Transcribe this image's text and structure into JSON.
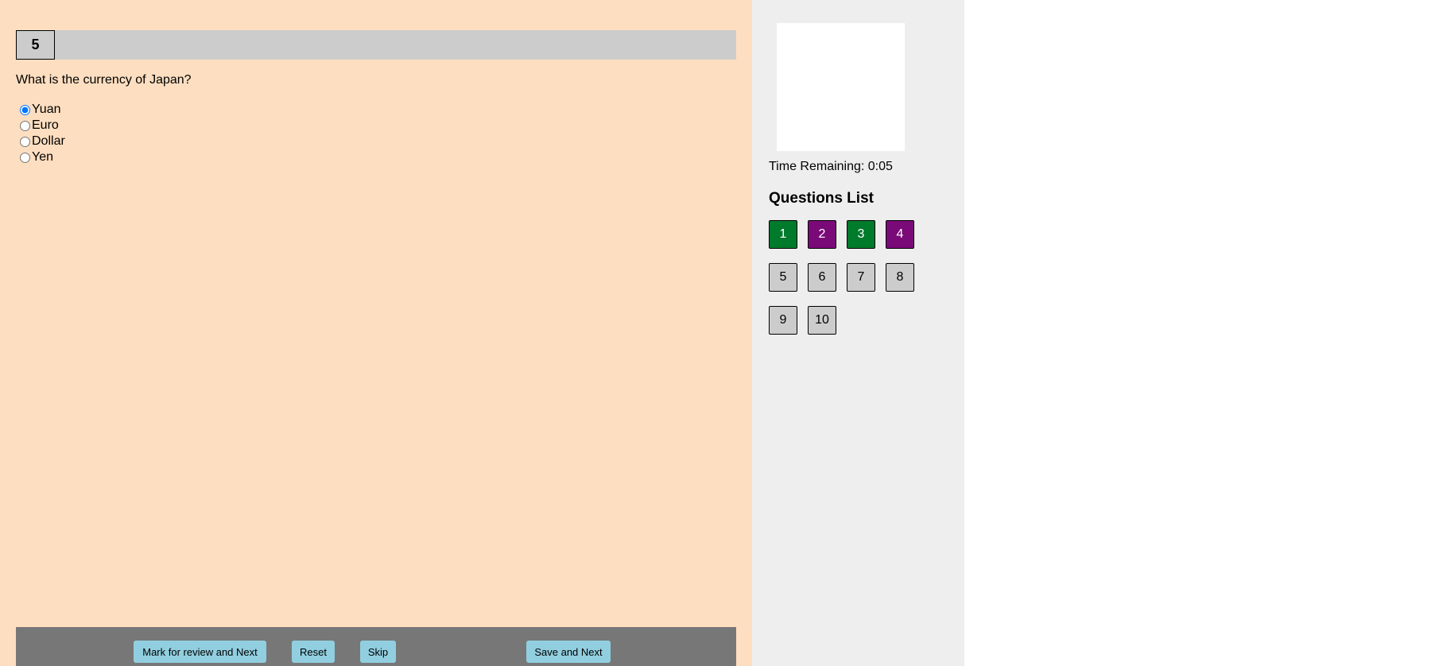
{
  "question": {
    "number": "5",
    "text": "What is the currency of Japan?",
    "options": [
      "Yuan",
      "Euro",
      "Dollar",
      "Yen"
    ],
    "selected_option": "Yuan"
  },
  "actions": {
    "mark_review_label": "Mark for review and Next",
    "reset_label": "Reset",
    "skip_label": "Skip",
    "save_label": "Save and Next"
  },
  "sidebar": {
    "timer_label": "Time Remaining: 0:05",
    "questions_list_title": "Questions List",
    "questions": [
      {
        "label": "1",
        "status": "answered"
      },
      {
        "label": "2",
        "status": "review"
      },
      {
        "label": "3",
        "status": "answered"
      },
      {
        "label": "4",
        "status": "review"
      },
      {
        "label": "5",
        "status": "unvisited"
      },
      {
        "label": "6",
        "status": "unvisited"
      },
      {
        "label": "7",
        "status": "unvisited"
      },
      {
        "label": "8",
        "status": "unvisited"
      },
      {
        "label": "9",
        "status": "unvisited"
      },
      {
        "label": "10",
        "status": "unvisited"
      }
    ]
  },
  "colors": {
    "main_background": "#fddec0",
    "sidebar_background": "#eeeeee",
    "answered": "#007a2b",
    "review": "#7a0a78",
    "unvisited": "#cccccc",
    "action_button": "#91cfe0",
    "action_bar": "#777777"
  }
}
